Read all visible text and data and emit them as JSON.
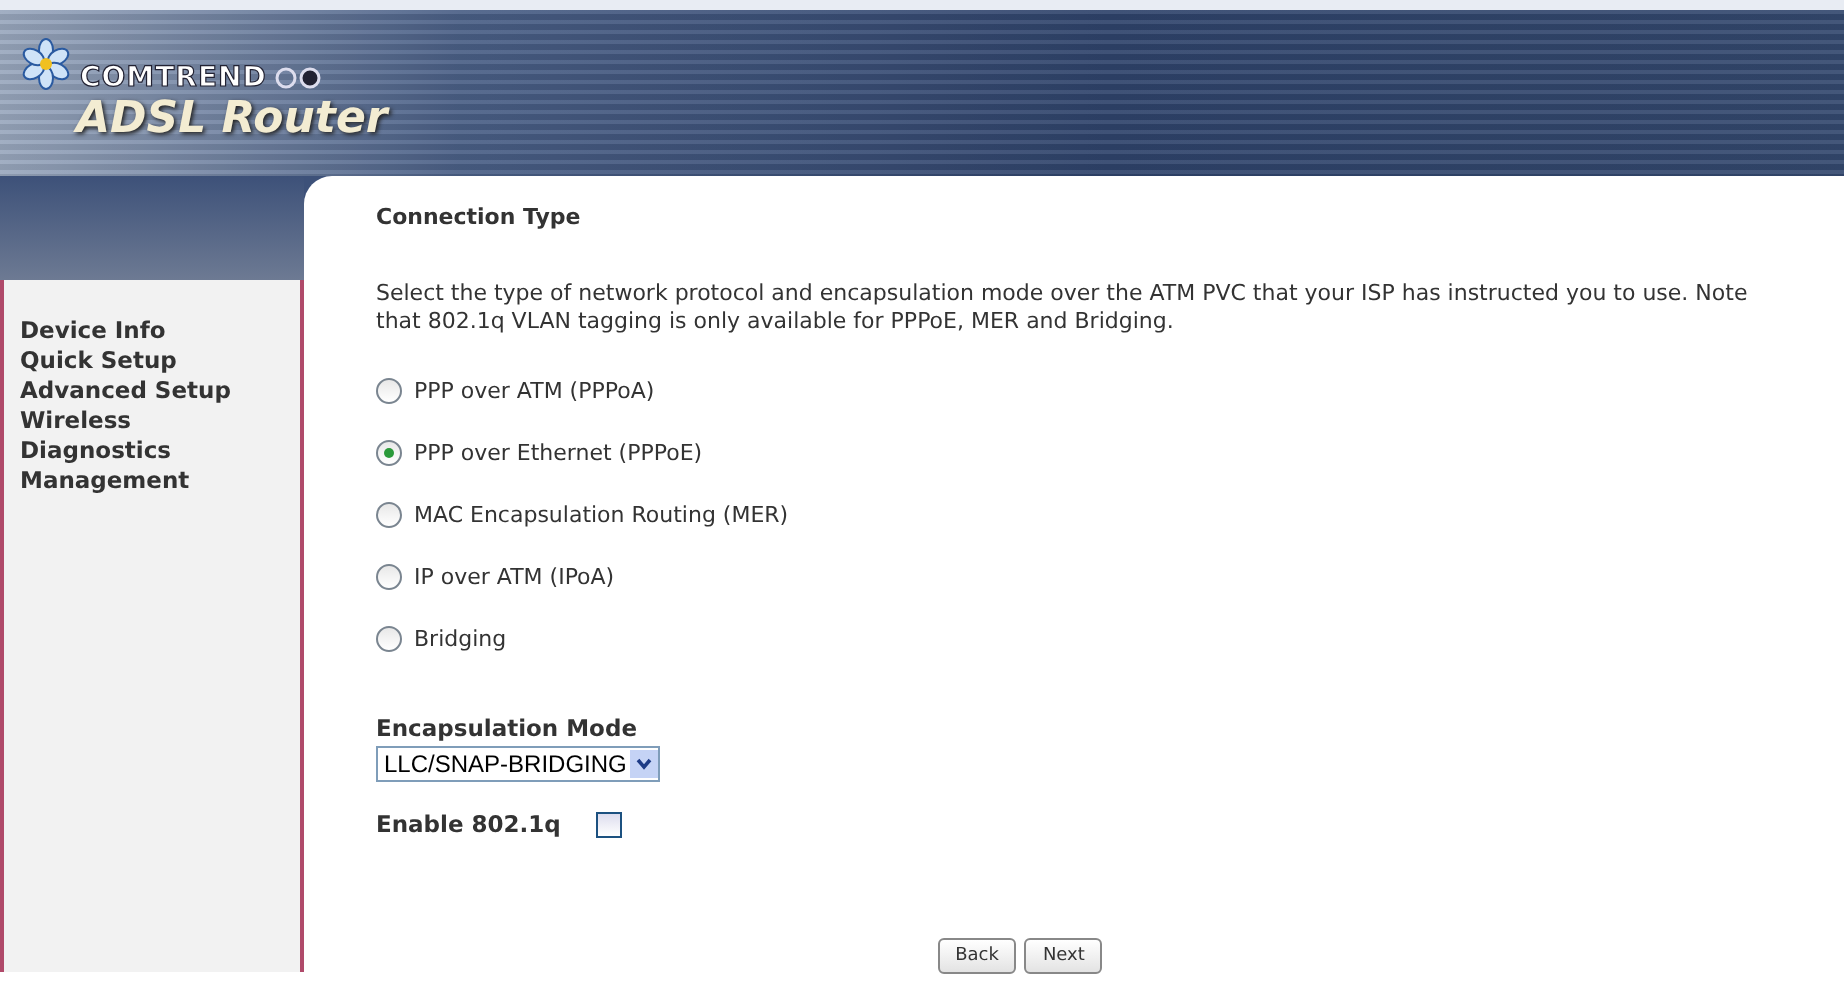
{
  "header": {
    "brand": "COMTREND",
    "product": "ADSL Router"
  },
  "sidebar": {
    "items": [
      {
        "label": "Device Info"
      },
      {
        "label": "Quick Setup"
      },
      {
        "label": "Advanced Setup"
      },
      {
        "label": "Wireless"
      },
      {
        "label": "Diagnostics"
      },
      {
        "label": "Management"
      }
    ]
  },
  "page_title": "Connection Type",
  "description": "Select the type of network protocol and encapsulation mode over the ATM PVC that your ISP has instructed you to use. Note that 802.1q VLAN tagging is only available for PPPoE, MER and Bridging.",
  "connection_types": [
    {
      "label": "PPP over ATM (PPPoA)",
      "selected": false
    },
    {
      "label": "PPP over Ethernet (PPPoE)",
      "selected": true
    },
    {
      "label": "MAC Encapsulation Routing (MER)",
      "selected": false
    },
    {
      "label": "IP over ATM (IPoA)",
      "selected": false
    },
    {
      "label": "Bridging",
      "selected": false
    }
  ],
  "encapsulation_mode": {
    "label": "Encapsulation Mode",
    "value": "LLC/SNAP-BRIDGING"
  },
  "enable_8021q": {
    "label": "Enable 802.1q",
    "checked": false
  },
  "buttons": [
    "Back",
    "Next"
  ]
}
